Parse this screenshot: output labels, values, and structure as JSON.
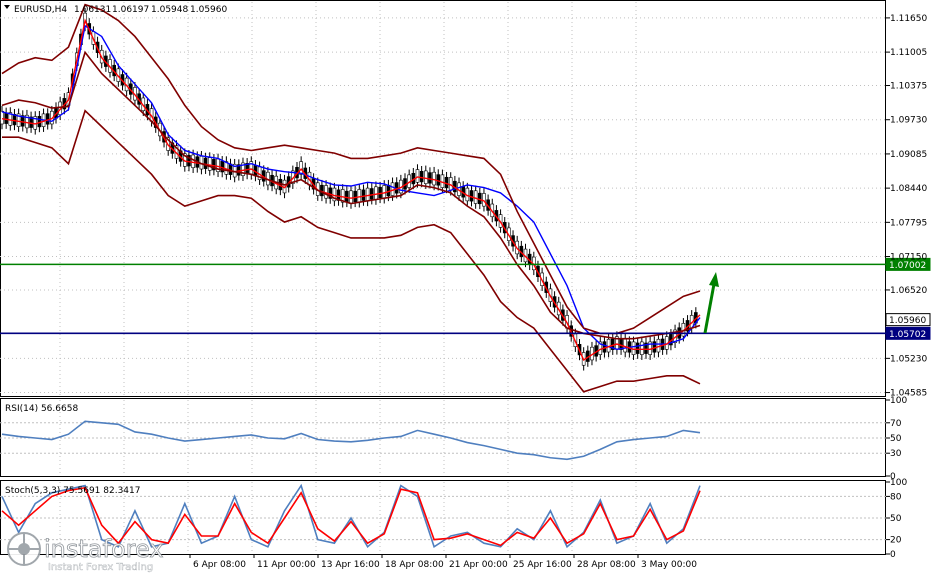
{
  "chart_data": [
    {
      "type": "line",
      "panel": "price",
      "title": "EURUSD,H4",
      "ohlc": [
        "1.06131",
        "1.06197",
        "1.05948",
        "1.05960"
      ],
      "y_ticks": [
        1.1165,
        1.11005,
        1.10375,
        1.0973,
        1.09085,
        1.0844,
        1.07795,
        1.0715,
        1.0652,
        1.0523,
        1.04585
      ],
      "ylim": [
        1.0452,
        1.1195
      ],
      "series": [
        {
          "color": "#0000ff",
          "values": [
            1.0988,
            1.098,
            1.0975,
            1.097,
            1.0992,
            1.115,
            1.113,
            1.1075,
            1.104,
            1.1005,
            1.0945,
            1.0915,
            1.0905,
            1.09,
            1.0885,
            1.089,
            1.088,
            1.0875,
            1.0872,
            1.086,
            1.085,
            1.0848,
            1.0855,
            1.0852,
            1.084,
            1.0835,
            1.083,
            1.084,
            1.085,
            1.0845,
            1.0835,
            1.081,
            1.078,
            1.072,
            1.066,
            1.058,
            1.055,
            1.054,
            1.0545,
            1.055,
            1.055,
            1.056,
            1.06
          ]
        },
        {
          "color": "#ff0000",
          "values": [
            1.0975,
            1.097,
            1.0965,
            1.0975,
            1.101,
            1.116,
            1.109,
            1.1055,
            1.102,
            1.098,
            1.0925,
            1.0895,
            1.089,
            1.0885,
            1.0875,
            1.088,
            1.086,
            1.0845,
            1.088,
            1.084,
            1.083,
            1.0825,
            1.083,
            1.0835,
            1.0845,
            1.0865,
            1.086,
            1.085,
            1.083,
            1.082,
            1.078,
            1.073,
            1.07,
            1.064,
            1.059,
            1.052,
            1.054,
            1.055,
            1.054,
            1.054,
            1.055,
            1.0575,
            1.0605
          ]
        },
        {
          "color": "#800000",
          "values": [
            1.1,
            1.101,
            1.1005,
            1.0995,
            1.0998,
            1.11,
            1.106,
            1.103,
            1.1,
            1.097,
            1.0935,
            1.0905,
            1.089,
            1.088,
            1.0875,
            1.087,
            1.086,
            1.085,
            1.086,
            1.084,
            1.0825,
            1.0815,
            1.082,
            1.0825,
            1.083,
            1.085,
            1.0845,
            1.0835,
            1.081,
            1.079,
            1.075,
            1.07,
            1.066,
            1.061,
            1.058,
            1.057,
            1.0565,
            1.056,
            1.056,
            1.0565,
            1.057,
            1.0575,
            1.0585
          ]
        },
        {
          "color": "#800000",
          "values": [
            1.106,
            1.108,
            1.109,
            1.1085,
            1.111,
            1.119,
            1.118,
            1.116,
            1.113,
            1.109,
            1.105,
            1.1,
            1.096,
            1.0935,
            1.092,
            1.0915,
            1.092,
            1.0925,
            1.092,
            1.0915,
            1.091,
            1.09,
            1.09,
            1.0905,
            1.091,
            1.092,
            1.0915,
            1.091,
            1.0905,
            1.09,
            1.087,
            1.08,
            1.074,
            1.068,
            1.062,
            1.058,
            1.057,
            1.057,
            1.058,
            1.06,
            1.062,
            1.064,
            1.065
          ]
        },
        {
          "color": "#800000",
          "values": [
            1.094,
            1.094,
            1.093,
            1.092,
            1.089,
            1.099,
            1.096,
            1.093,
            1.09,
            1.087,
            1.083,
            1.081,
            1.082,
            1.083,
            1.083,
            1.0825,
            1.08,
            1.078,
            1.079,
            1.077,
            1.076,
            1.075,
            1.075,
            1.075,
            1.0755,
            1.077,
            1.0775,
            1.076,
            1.072,
            1.068,
            1.063,
            1.06,
            1.058,
            1.054,
            1.05,
            1.046,
            1.047,
            1.048,
            1.048,
            1.0485,
            1.049,
            1.049,
            1.0475
          ]
        }
      ],
      "h_levels": [
        {
          "value": 1.07002,
          "label": "1.07002",
          "color": "#008000"
        },
        {
          "value": 1.0596,
          "label": "1.05960",
          "color": "#000000"
        },
        {
          "value": 1.05702,
          "label": "1.05702",
          "color": "#000080"
        }
      ]
    },
    {
      "type": "line",
      "panel": "rsi",
      "title": "RSI(14) 56.6658",
      "y_ticks": [
        100,
        70,
        50,
        30,
        0
      ],
      "ylim": [
        0,
        100
      ],
      "series": [
        {
          "color": "#4f7fbf",
          "values": [
            55,
            52,
            50,
            48,
            55,
            72,
            70,
            68,
            58,
            55,
            50,
            46,
            48,
            50,
            52,
            54,
            50,
            49,
            56,
            48,
            46,
            45,
            47,
            50,
            52,
            60,
            55,
            50,
            44,
            40,
            35,
            30,
            28,
            24,
            22,
            26,
            35,
            45,
            48,
            50,
            52,
            60,
            57
          ]
        }
      ]
    },
    {
      "type": "line",
      "panel": "stochastic",
      "title": "Stoch(5,3,3) 75.5691 82.3417",
      "y_ticks": [
        100,
        80,
        50,
        20,
        0
      ],
      "ylim": [
        0,
        100
      ],
      "series": [
        {
          "color": "#4f7fbf",
          "values": [
            80,
            30,
            70,
            85,
            90,
            95,
            20,
            10,
            60,
            10,
            15,
            70,
            15,
            25,
            80,
            20,
            10,
            60,
            95,
            20,
            15,
            50,
            10,
            30,
            95,
            80,
            10,
            25,
            30,
            15,
            10,
            35,
            20,
            60,
            10,
            30,
            75,
            15,
            25,
            70,
            15,
            35,
            95
          ]
        },
        {
          "color": "#ff0000",
          "values": [
            60,
            40,
            60,
            80,
            88,
            92,
            40,
            15,
            45,
            20,
            15,
            55,
            25,
            25,
            70,
            30,
            15,
            50,
            85,
            35,
            18,
            45,
            15,
            28,
            90,
            85,
            20,
            22,
            28,
            20,
            12,
            30,
            22,
            50,
            15,
            28,
            70,
            20,
            25,
            62,
            20,
            32,
            88
          ]
        }
      ]
    },
    {
      "x_labels": [
        "6 Apr 08:00",
        "11 Apr 00:00",
        "13 Apr 16:00",
        "18 Apr 08:00",
        "21 Apr 00:00",
        "25 Apr 16:00",
        "28 Apr 08:00",
        "3 May 00:00"
      ]
    }
  ],
  "watermark": {
    "brand": "instaforex",
    "tagline": "Instant Forex Trading"
  },
  "colors": {
    "grid": "#c0c0c0",
    "axis": "#000000",
    "bull_candle": "#ffffff",
    "bear_candle": "#000000",
    "arrow": "#008000"
  }
}
